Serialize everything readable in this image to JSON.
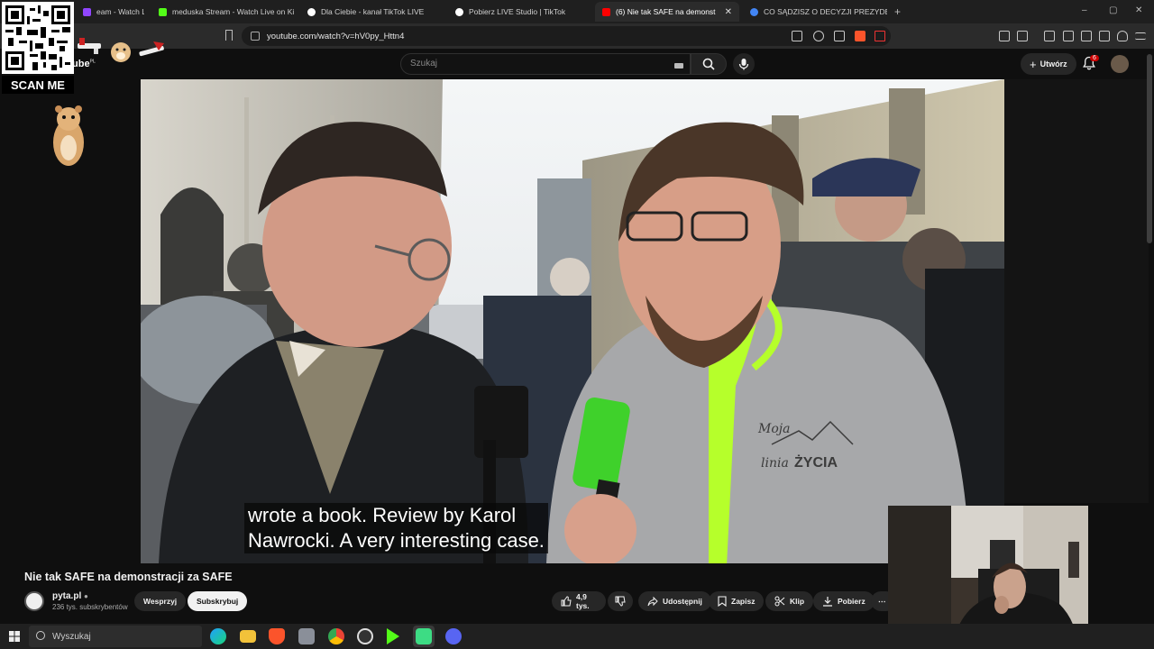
{
  "browser": {
    "tabs": [
      {
        "label": "eam - Watch Live on",
        "color": "#9146ff",
        "active": false
      },
      {
        "label": "meduska Stream - Watch Live on Kic",
        "color": "#53fc18",
        "active": false
      },
      {
        "label": "Dla Ciebie - kanał TikTok LIVE",
        "color": "#ffffff",
        "active": false
      },
      {
        "label": "Pobierz LIVE Studio | TikTok",
        "color": "#ffffff",
        "active": false
      },
      {
        "label": "(6) Nie tak SAFE na demonst",
        "color": "#ff0000",
        "active": true
      },
      {
        "label": "CO SĄDZISZ O DECYZJI PREZYDENTA",
        "color": "#4285f4",
        "active": false
      }
    ],
    "new_tab": "+",
    "url": "youtube.com/watch?v=hV0py_Httn4",
    "window_controls": [
      "–",
      "▢",
      "✕"
    ]
  },
  "youtube": {
    "logo_suffix": "ube",
    "logo_region": "PL",
    "search_placeholder": "Szukaj",
    "create_label": "Utwórz",
    "notifications_count": "6"
  },
  "overlay": {
    "scan_label": "SCAN ME"
  },
  "video": {
    "caption_line1": "wrote a book.  Review by Karol",
    "caption_line2": "Nawrocki.  A very interesting case.",
    "hoodie_text_1": "Moja",
    "hoodie_text_2": "linia",
    "hoodie_text_3": "ŻYCIA",
    "title": "Nie tak SAFE na demonstracji za SAFE"
  },
  "channel": {
    "name": "pyta.pl",
    "subscribers": "236 tys. subskrybentów",
    "support_label": "Wesprzyj",
    "subscribe_label": "Subskrybuj"
  },
  "actions": {
    "likes": "4,9 tys.",
    "share": "Udostępnij",
    "save": "Zapisz",
    "clip": "Klip",
    "download": "Pobierz",
    "more": "⋯"
  },
  "taskbar": {
    "search_placeholder": "Wyszukaj"
  },
  "colors": {
    "accent_red": "#ff0000",
    "background": "#0f0f0f",
    "pill": "#272727",
    "neon_green": "#b7ff2a"
  }
}
